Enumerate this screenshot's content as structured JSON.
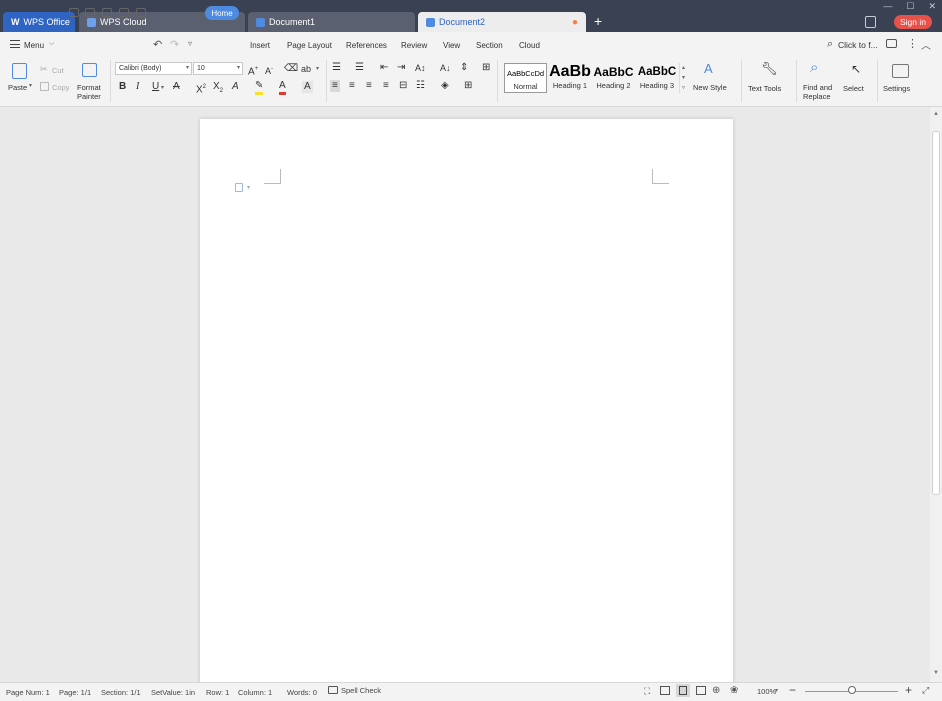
{
  "titlebar": {
    "tabs": [
      {
        "label": "WPS Office"
      },
      {
        "label": "WPS Cloud"
      },
      {
        "label": "Document1"
      },
      {
        "label": "Document2"
      }
    ],
    "new_tab": "+",
    "sign_in": "Sign in"
  },
  "menubar": {
    "menu": "Menu",
    "items": [
      "Home",
      "Insert",
      "Page Layout",
      "References",
      "Review",
      "View",
      "Section",
      "Cloud"
    ],
    "search": "Click to f..."
  },
  "ribbon": {
    "paste": "Paste",
    "cut": "Cut",
    "copy": "Copy",
    "format_painter_1": "Format",
    "format_painter_2": "Painter",
    "font_name": "Calibri (Body)",
    "font_size": "10",
    "styles": [
      {
        "sample": "AaBbCcDd",
        "name": "Normal"
      },
      {
        "sample": "AaBb",
        "name": "Heading 1"
      },
      {
        "sample": "AaBbC",
        "name": "Heading 2"
      },
      {
        "sample": "AaBbC",
        "name": "Heading 3"
      }
    ],
    "new_style": "New Style",
    "text_tools": "Text Tools",
    "find_replace_1": "Find and",
    "find_replace_2": "Replace",
    "select": "Select",
    "settings": "Settings"
  },
  "status": {
    "page_num": "Page Num: 1",
    "page": "Page: 1/1",
    "section": "Section: 1/1",
    "setvalue": "SetValue: 1in",
    "row": "Row: 1",
    "column": "Column: 1",
    "words": "Words: 0",
    "spell_check": "Spell Check",
    "zoom": "100%",
    "zoom_level": 0.5
  },
  "colors": {
    "accent": "#4e8be0",
    "titlebar": "#3a4152",
    "sign_in": "#e8514a",
    "font_color_red": "#e03a2f",
    "highlight_yellow": "#f7e028"
  }
}
